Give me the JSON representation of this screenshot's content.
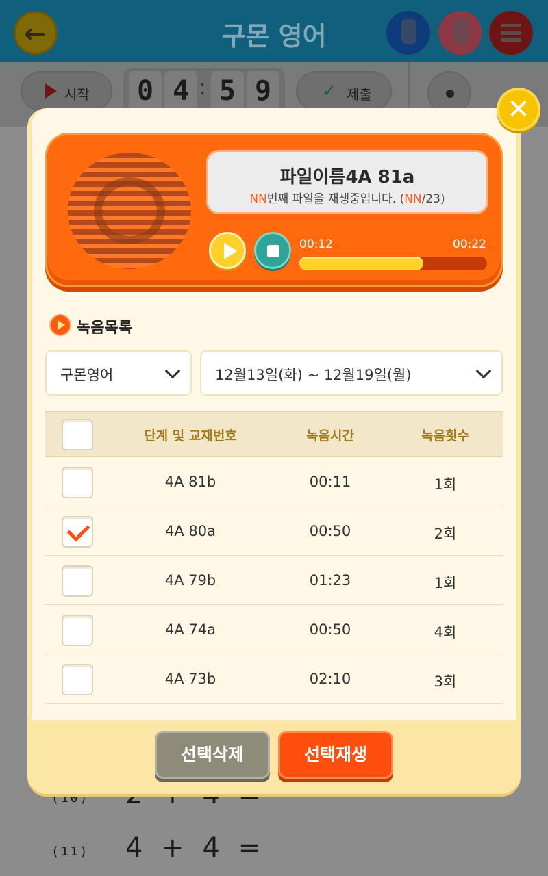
{
  "header": {
    "title": "구몬 영어",
    "back_icon": "back-arrow-icon"
  },
  "toolbar": {
    "start_label": "시작",
    "timer_digits": [
      "0",
      "4",
      "5",
      "9"
    ],
    "timer_separator": ":",
    "submit_label": "제출"
  },
  "worksheet": {
    "rows": [
      {
        "num": "(10)",
        "expr": "2 + 4 ="
      },
      {
        "num": "(11)",
        "expr": "4 + 4 ="
      }
    ]
  },
  "player": {
    "file_name": "파일이름4A 81a",
    "status_nn": "NN",
    "status_text": "번째 파일을 재생중입니다. (",
    "status_nn2": "NN",
    "status_total": "/23)",
    "current_time": "00:12",
    "total_time": "00:22",
    "progress": 0.66
  },
  "recordings": {
    "section_title": "녹음목록",
    "subject_select": "구몬영어",
    "date_select": "12월13일(화) ~ 12월19일(월)",
    "columns": [
      "단계 및 교재번호",
      "녹음시간",
      "녹음횟수"
    ],
    "rows": [
      {
        "item": "4A 81b",
        "time": "00:11",
        "count": "1회",
        "checked": false
      },
      {
        "item": "4A 80a",
        "time": "00:50",
        "count": "2회",
        "checked": true
      },
      {
        "item": "4A 79b",
        "time": "01:23",
        "count": "1회",
        "checked": false
      },
      {
        "item": "4A 74a",
        "time": "00:50",
        "count": "4회",
        "checked": false
      },
      {
        "item": "4A 73b",
        "time": "02:10",
        "count": "3회",
        "checked": false
      }
    ]
  },
  "actions": {
    "delete_label": "선택삭제",
    "play_label": "선택재생"
  },
  "colors": {
    "accent": "#ff5a12",
    "header_bg": "#0f5f7d",
    "modal_bg": "#fff8e7"
  }
}
